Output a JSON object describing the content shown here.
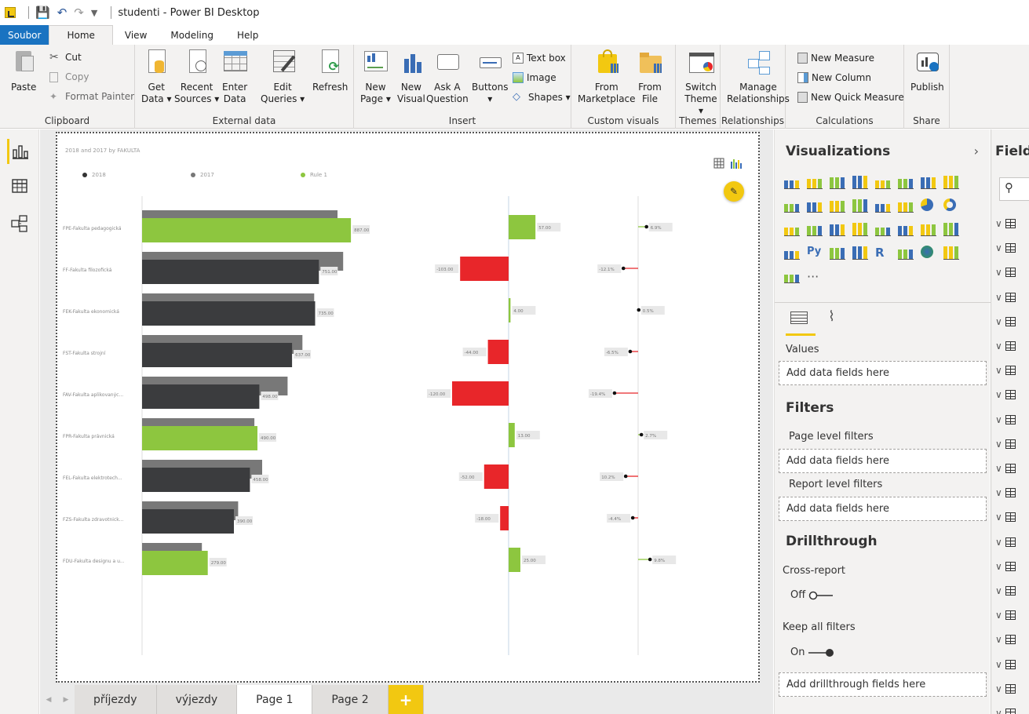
{
  "window": {
    "title": "studenti - Power BI Desktop"
  },
  "tabs": [
    {
      "label": "Soubor"
    },
    {
      "label": "Home"
    },
    {
      "label": "View"
    },
    {
      "label": "Modeling"
    },
    {
      "label": "Help"
    }
  ],
  "ribbon": {
    "clipboard": {
      "group": "Clipboard",
      "paste": "Paste",
      "cut": "Cut",
      "copy": "Copy",
      "format_painter": "Format Painter"
    },
    "external": {
      "group": "External data",
      "get_data_1": "Get",
      "get_data_2": "Data",
      "recent_1": "Recent",
      "recent_2": "Sources",
      "enter_1": "Enter",
      "enter_2": "Data",
      "edit_1": "Edit",
      "edit_2": "Queries",
      "refresh": "Refresh"
    },
    "insert": {
      "group": "Insert",
      "new_page_1": "New",
      "new_page_2": "Page",
      "new_visual_1": "New",
      "new_visual_2": "Visual",
      "ask_1": "Ask A",
      "ask_2": "Question",
      "buttons": "Buttons",
      "text_box": "Text box",
      "image": "Image",
      "shapes": "Shapes"
    },
    "custom": {
      "group": "Custom visuals",
      "market_1": "From",
      "market_2": "Marketplace",
      "file_1": "From",
      "file_2": "File"
    },
    "themes": {
      "group": "Themes",
      "switch_1": "Switch",
      "switch_2": "Theme"
    },
    "relationships": {
      "group": "Relationships",
      "manage_1": "Manage",
      "manage_2": "Relationships"
    },
    "calculations": {
      "group": "Calculations",
      "new_measure": "New Measure",
      "new_column": "New Column",
      "new_quick_measure": "New Quick Measure"
    },
    "share": {
      "group": "Share",
      "publish": "Publish"
    }
  },
  "visual": {
    "title": "2018 and 2017 by FAKULTA",
    "legend": [
      {
        "label": "2018",
        "color": "#333333"
      },
      {
        "label": "2017",
        "color": "#777777"
      },
      {
        "label": "Rule 1",
        "color": "#8dc63f"
      }
    ]
  },
  "chart_data": {
    "type": "bar",
    "categories": [
      "FPE-Fakulta pedagogická",
      "FF-Fakulta filozofická",
      "FEK-Fakulta ekonomická",
      "FST-Fakulta strojní",
      "FAV-Fakulta aplikovanýc...",
      "FPR-Fakulta právnická",
      "FEL-Fakulta elektrotech...",
      "FZS-Fakulta zdravotnick...",
      "FDU-Fakulta designu a u..."
    ],
    "series": [
      {
        "name": "2018",
        "values": [
          887,
          751,
          735,
          637,
          498,
          490,
          458,
          390,
          279
        ]
      },
      {
        "name": "2017",
        "values": [
          830,
          854,
          731,
          681,
          618,
          477,
          510,
          408,
          254
        ]
      }
    ],
    "highlight_rule": [
      true,
      false,
      false,
      false,
      false,
      true,
      false,
      false,
      true
    ],
    "difference": [
      57,
      -103,
      4,
      -44,
      -120,
      13,
      -52,
      -18,
      25
    ],
    "difference_labels": [
      "57.00",
      "-103.00",
      "4.00",
      "-44.00",
      "-120.00",
      "13.00",
      "-52.00",
      "-18.00",
      "25.00"
    ],
    "percent_change": [
      6.9,
      -12.1,
      0.5,
      -6.5,
      -19.4,
      2.7,
      -10.2,
      -4.4,
      9.8
    ],
    "percent_labels": [
      "6.9%",
      "-12.1%",
      "0.5%",
      "-6.5%",
      "-19.4%",
      "2.7%",
      "10.2%",
      "-4.4%",
      "9.8%"
    ],
    "value_labels": [
      "887.00",
      "751.00",
      "735.00",
      "637.00",
      "498.00",
      "490.00",
      "458.00",
      "390.00",
      "279.00"
    ]
  },
  "page_tabs": [
    {
      "label": "příjezdy"
    },
    {
      "label": "výjezdy"
    },
    {
      "label": "Page 1"
    },
    {
      "label": "Page 2"
    }
  ],
  "viz_pane": {
    "title": "Visualizations",
    "values_label": "Values",
    "values_placeholder": "Add data fields here",
    "filters_title": "Filters",
    "page_filters": "Page level filters",
    "page_filters_placeholder": "Add data fields here",
    "report_filters": "Report level filters",
    "report_filters_placeholder": "Add data fields here",
    "drill_title": "Drillthrough",
    "cross_report": "Cross-report",
    "cross_report_state": "Off",
    "keep_filters": "Keep all filters",
    "keep_filters_state": "On",
    "drill_placeholder": "Add drillthrough fields here"
  },
  "fields_pane": {
    "title": "Field"
  },
  "colors": {
    "accent": "#f2c811",
    "green": "#8dc63f",
    "red": "#e8262a",
    "dark": "#3b3c3e",
    "gray": "#787878",
    "file_tab": "#1a73c1"
  }
}
